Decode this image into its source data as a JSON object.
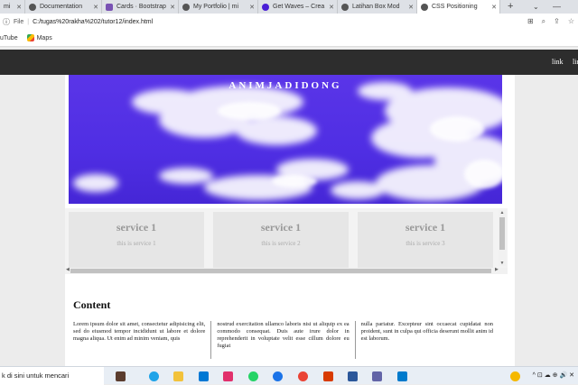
{
  "browser": {
    "tabs": [
      {
        "label": "mi",
        "active": false
      },
      {
        "label": "Documentation",
        "active": false
      },
      {
        "label": "Cards · Bootstrap",
        "active": false
      },
      {
        "label": "My Portfolio | mi",
        "active": false
      },
      {
        "label": "Get Waves – Crea",
        "active": false
      },
      {
        "label": "Latihan Box Mod",
        "active": false
      },
      {
        "label": "CSS Positioning",
        "active": true
      }
    ],
    "new_tab": "+",
    "address": {
      "scheme_label": "File",
      "url": "C:/tugas%20rakha%202/tutor12/index.html"
    },
    "bookmarks": [
      {
        "label": "uTube"
      },
      {
        "label": "Maps"
      }
    ]
  },
  "page": {
    "nav_links": [
      "link",
      "lin"
    ],
    "hero_brand": "ANIMJADIDONG",
    "services": [
      {
        "title": "service 1",
        "subtitle": "this is service 1"
      },
      {
        "title": "service 1",
        "subtitle": "this is service 2"
      },
      {
        "title": "service 1",
        "subtitle": "this is service 3"
      }
    ],
    "content_title": "Content",
    "content_columns": [
      "Lorem ipsum dolor sit amet, consectetur adipisicing elit, sed do eiusmod tempor incididunt ut labore et dolore magna aliqua. Ut enim ad minim veniam, quis",
      "nostrud exercitation ullamco laboris nisi ut aliquip ex ea commodo consequat. Duis aute irure dolor in reprehenderit in voluptate velit esse cillum dolore eu fugiat",
      "nulla pariatur. Excepteur sint occaecat cupidatat non proident, sunt in culpa qui officia deserunt mollit anim id est laborum."
    ]
  },
  "taskbar": {
    "search_text": "k di sini untuk mencari",
    "tray_text": "^ ⊡ ☁ ⊕ 🔊 ✕"
  },
  "colors": {
    "hero_sky": "#5a35e8",
    "navbar": "#2d2d2d",
    "service_card": "#e6e6e6"
  }
}
